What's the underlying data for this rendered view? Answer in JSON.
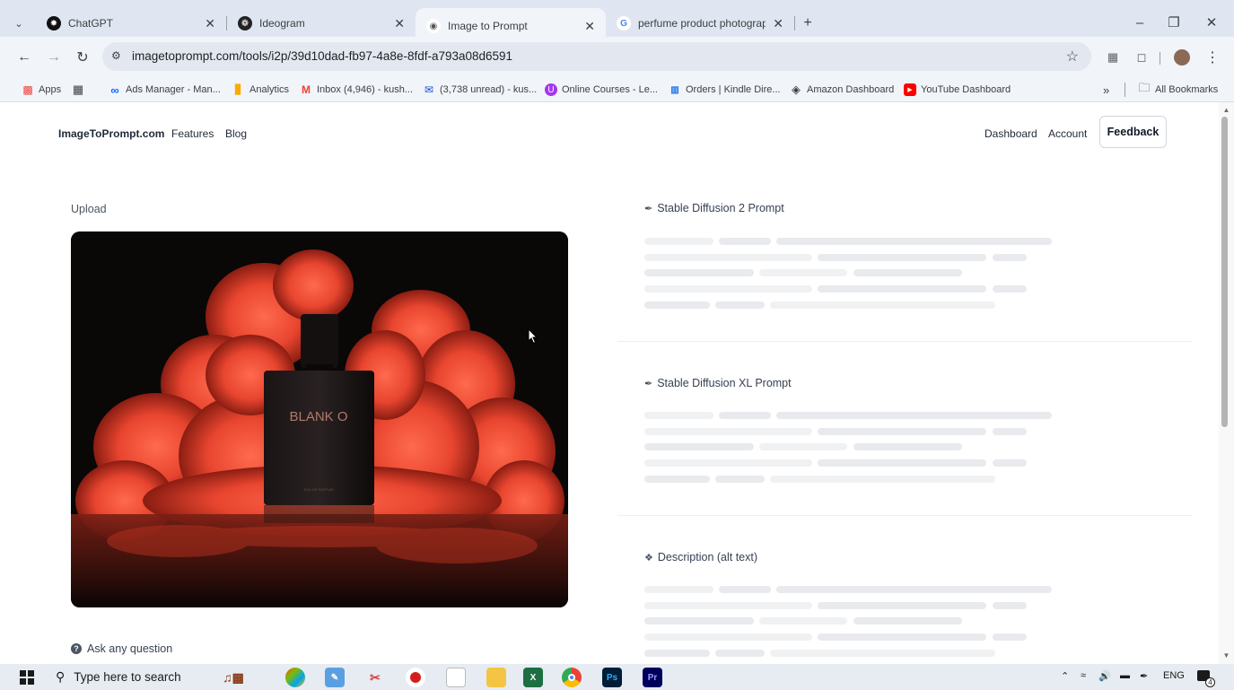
{
  "browser": {
    "tabs": [
      {
        "title": "ChatGPT",
        "favicon": "chatgpt-icon",
        "active": false
      },
      {
        "title": "Ideogram",
        "favicon": "ideogram-icon",
        "active": false
      },
      {
        "title": "Image to Prompt",
        "favicon": "cake-icon",
        "active": true
      },
      {
        "title": "perfume product photography",
        "favicon": "google-icon",
        "active": false
      }
    ],
    "new_tab": "+",
    "url": "imagetoprompt.com/tools/i2p/39d10dad-fb97-4a8e-8fdf-a793a08d6591",
    "bookmarks": [
      {
        "label": "Apps",
        "icon": "apps-grid-icon"
      },
      {
        "label": "Ads Manager - Man...",
        "icon": "meta-icon"
      },
      {
        "label": "Analytics",
        "icon": "analytics-icon"
      },
      {
        "label": "Inbox (4,946) - kush...",
        "icon": "gmail-icon"
      },
      {
        "label": "(3,738 unread) - kus...",
        "icon": "mail-icon"
      },
      {
        "label": "Online Courses - Le...",
        "icon": "udemy-icon"
      },
      {
        "label": "Orders | Kindle Dire...",
        "icon": "kindle-icon"
      },
      {
        "label": "Amazon Dashboard",
        "icon": "globe-icon"
      },
      {
        "label": "YouTube Dashboard",
        "icon": "youtube-icon"
      }
    ],
    "more_bookmarks": "»",
    "all_bookmarks": "All Bookmarks"
  },
  "site": {
    "brand": "ImageToPrompt.com",
    "nav": [
      "Features",
      "Blog"
    ],
    "right_nav": [
      "Dashboard",
      "Account"
    ],
    "feedback": "Feedback"
  },
  "main": {
    "upload_label": "Upload",
    "image": {
      "brand_text": "BLANK O",
      "subtext": "EAU DE PARFUM"
    },
    "sections": [
      {
        "title": "Stable Diffusion 2 Prompt",
        "icon": "pencil-icon"
      },
      {
        "title": "Stable Diffusion XL Prompt",
        "icon": "pencil-icon"
      },
      {
        "title": "Description (alt text)",
        "icon": "info-icon"
      }
    ],
    "ask_label": "Ask any question"
  },
  "taskbar": {
    "search_placeholder": "Type here to search",
    "tray_lang": "ENG",
    "notification_count": "4"
  },
  "colors": {
    "accent": "#1a73e8",
    "smoke": "#e8452f",
    "skeleton": "#e8eaed"
  }
}
